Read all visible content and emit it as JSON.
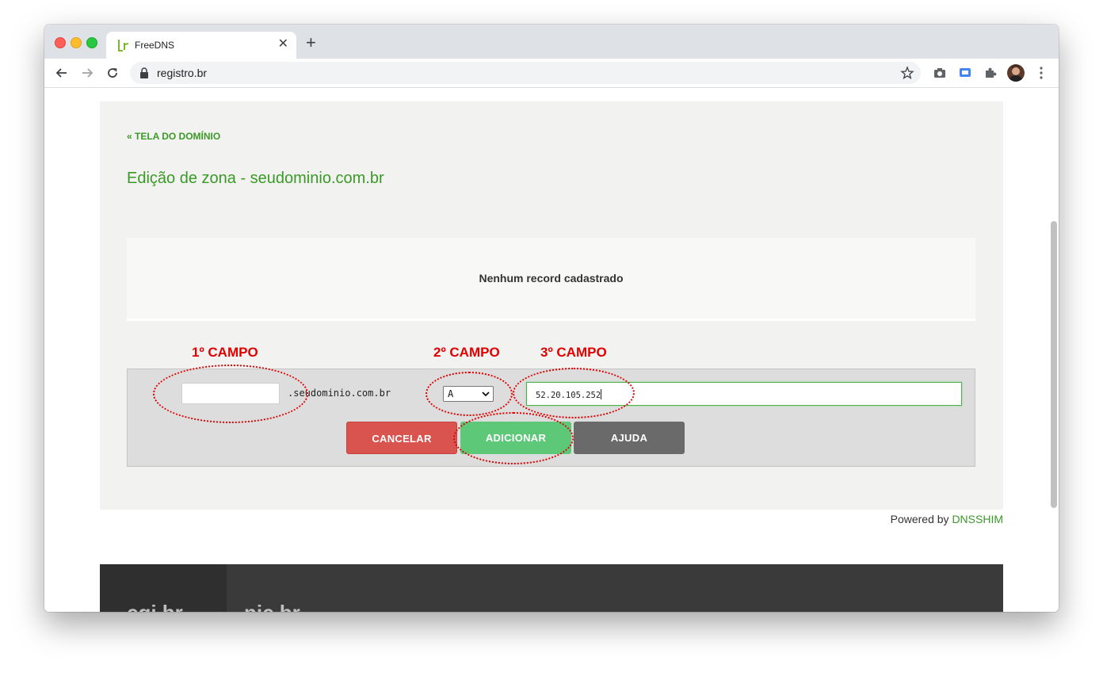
{
  "browser": {
    "tab_title": "FreeDNS",
    "url": "registro.br",
    "favicon": "registro-br-favicon"
  },
  "page": {
    "back_link": "« TELA DO DOMÍNIO",
    "title": "Edição de zona - seudominio.com.br",
    "records_empty": "Nenhum record cadastrado"
  },
  "form": {
    "name_value": "",
    "domain_suffix": ".seudominio.com.br",
    "type_selected": "A",
    "value_input": "52.20.105.252",
    "cancel_label": "CANCELAR",
    "add_label": "ADICIONAR",
    "help_label": "AJUDA"
  },
  "annotations": {
    "field1": "1º CAMPO",
    "field2": "2º CAMPO",
    "field3": "3º CAMPO",
    "color": "#e00000"
  },
  "footer": {
    "powered_prefix": "Powered by ",
    "powered_link": "DNSSHIM",
    "logo_cgi": "cgi.br",
    "logo_nic": "nic.br"
  },
  "colors": {
    "accent_green": "#3a9a27",
    "cancel_red": "#d9534f",
    "add_green": "#5cc878",
    "help_gray": "#6a6a6a"
  }
}
